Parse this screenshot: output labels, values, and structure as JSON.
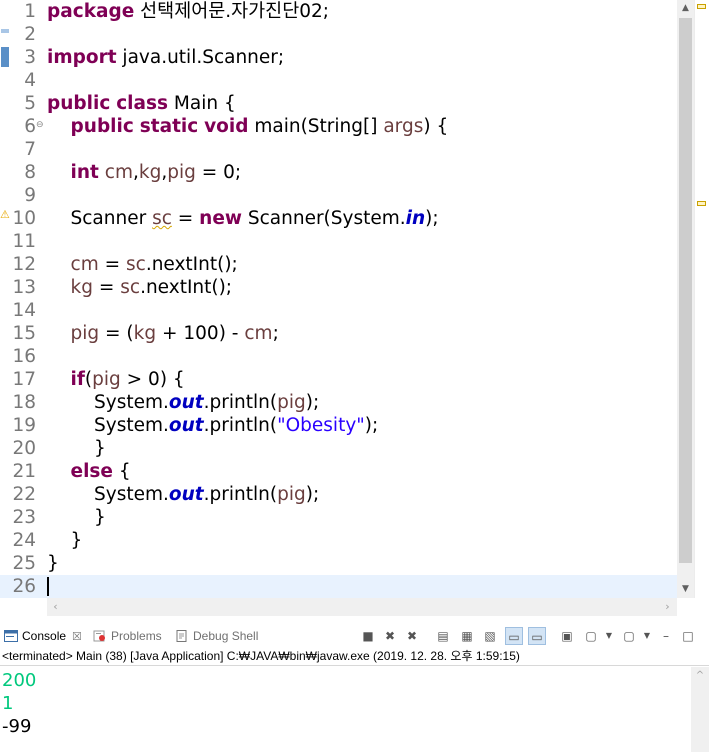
{
  "editor": {
    "lines": [
      {
        "n": "1",
        "tokens": [
          {
            "t": "package",
            "c": "kw"
          },
          {
            "t": " 선택제어문.자가진단02;",
            "c": ""
          }
        ]
      },
      {
        "n": "2",
        "tokens": []
      },
      {
        "n": "3",
        "tokens": [
          {
            "t": "import",
            "c": "kw"
          },
          {
            "t": " java.util.Scanner;",
            "c": ""
          }
        ]
      },
      {
        "n": "4",
        "tokens": []
      },
      {
        "n": "5",
        "tokens": [
          {
            "t": "public",
            "c": "kw"
          },
          {
            "t": " ",
            "c": ""
          },
          {
            "t": "class",
            "c": "kw"
          },
          {
            "t": " Main {",
            "c": ""
          }
        ]
      },
      {
        "n": "6",
        "fold": true,
        "tokens": [
          {
            "t": "    ",
            "c": ""
          },
          {
            "t": "public",
            "c": "kw"
          },
          {
            "t": " ",
            "c": ""
          },
          {
            "t": "static",
            "c": "kw"
          },
          {
            "t": " ",
            "c": ""
          },
          {
            "t": "void",
            "c": "kw"
          },
          {
            "t": " main(String[] ",
            "c": ""
          },
          {
            "t": "args",
            "c": "var"
          },
          {
            "t": ") {",
            "c": ""
          }
        ]
      },
      {
        "n": "7",
        "tokens": []
      },
      {
        "n": "8",
        "tokens": [
          {
            "t": "    ",
            "c": ""
          },
          {
            "t": "int",
            "c": "kw"
          },
          {
            "t": " ",
            "c": ""
          },
          {
            "t": "cm",
            "c": "var"
          },
          {
            "t": ",",
            "c": ""
          },
          {
            "t": "kg",
            "c": "var"
          },
          {
            "t": ",",
            "c": ""
          },
          {
            "t": "pig",
            "c": "var"
          },
          {
            "t": " = 0;",
            "c": ""
          }
        ]
      },
      {
        "n": "9",
        "tokens": []
      },
      {
        "n": "10",
        "warn": true,
        "tokens": [
          {
            "t": "    Scanner ",
            "c": ""
          },
          {
            "t": "sc",
            "c": "var squig"
          },
          {
            "t": " = ",
            "c": ""
          },
          {
            "t": "new",
            "c": "kw"
          },
          {
            "t": " Scanner(System.",
            "c": ""
          },
          {
            "t": "in",
            "c": "fld"
          },
          {
            "t": ");",
            "c": ""
          }
        ]
      },
      {
        "n": "11",
        "tokens": []
      },
      {
        "n": "12",
        "tokens": [
          {
            "t": "    ",
            "c": ""
          },
          {
            "t": "cm",
            "c": "var"
          },
          {
            "t": " = ",
            "c": ""
          },
          {
            "t": "sc",
            "c": "var"
          },
          {
            "t": ".nextInt();",
            "c": ""
          }
        ]
      },
      {
        "n": "13",
        "tokens": [
          {
            "t": "    ",
            "c": ""
          },
          {
            "t": "kg",
            "c": "var"
          },
          {
            "t": " = ",
            "c": ""
          },
          {
            "t": "sc",
            "c": "var"
          },
          {
            "t": ".nextInt();",
            "c": ""
          }
        ]
      },
      {
        "n": "14",
        "tokens": []
      },
      {
        "n": "15",
        "tokens": [
          {
            "t": "    ",
            "c": ""
          },
          {
            "t": "pig",
            "c": "var"
          },
          {
            "t": " = (",
            "c": ""
          },
          {
            "t": "kg",
            "c": "var"
          },
          {
            "t": " + 100) - ",
            "c": ""
          },
          {
            "t": "cm",
            "c": "var"
          },
          {
            "t": ";",
            "c": ""
          }
        ]
      },
      {
        "n": "16",
        "tokens": []
      },
      {
        "n": "17",
        "tokens": [
          {
            "t": "    ",
            "c": ""
          },
          {
            "t": "if",
            "c": "kw"
          },
          {
            "t": "(",
            "c": ""
          },
          {
            "t": "pig",
            "c": "var"
          },
          {
            "t": " > 0) {",
            "c": ""
          }
        ]
      },
      {
        "n": "18",
        "tokens": [
          {
            "t": "        System.",
            "c": ""
          },
          {
            "t": "out",
            "c": "fld"
          },
          {
            "t": ".println(",
            "c": ""
          },
          {
            "t": "pig",
            "c": "var"
          },
          {
            "t": ");",
            "c": ""
          }
        ]
      },
      {
        "n": "19",
        "tokens": [
          {
            "t": "        System.",
            "c": ""
          },
          {
            "t": "out",
            "c": "fld"
          },
          {
            "t": ".println(",
            "c": ""
          },
          {
            "t": "\"Obesity\"",
            "c": "str"
          },
          {
            "t": ");",
            "c": ""
          }
        ]
      },
      {
        "n": "20",
        "tokens": [
          {
            "t": "        }",
            "c": ""
          }
        ]
      },
      {
        "n": "21",
        "tokens": [
          {
            "t": "    ",
            "c": ""
          },
          {
            "t": "else",
            "c": "kw"
          },
          {
            "t": " {",
            "c": ""
          }
        ]
      },
      {
        "n": "22",
        "tokens": [
          {
            "t": "        System.",
            "c": ""
          },
          {
            "t": "out",
            "c": "fld"
          },
          {
            "t": ".println(",
            "c": ""
          },
          {
            "t": "pig",
            "c": "var"
          },
          {
            "t": ");",
            "c": ""
          }
        ]
      },
      {
        "n": "23",
        "tokens": [
          {
            "t": "        }",
            "c": ""
          }
        ]
      },
      {
        "n": "24",
        "tokens": [
          {
            "t": "    }",
            "c": ""
          }
        ]
      },
      {
        "n": "25",
        "tokens": [
          {
            "t": "}",
            "c": ""
          }
        ]
      },
      {
        "n": "26",
        "current": true,
        "tokens": []
      }
    ]
  },
  "console": {
    "tabs": [
      {
        "label": "Console",
        "active": true,
        "icon": "console-icon"
      },
      {
        "label": "Problems",
        "active": false,
        "icon": "problems-icon"
      },
      {
        "label": "Debug Shell",
        "active": false,
        "icon": "debug-shell-icon"
      }
    ],
    "close_glyph": "☒",
    "status": "<terminated> Main (38) [Java Application] C:₩JAVA₩bin₩javaw.exe (2019. 12. 28. 오후 1:59:15)",
    "output": [
      {
        "text": "200",
        "kind": "in"
      },
      {
        "text": "1",
        "kind": "in"
      },
      {
        "text": "-99",
        "kind": "std"
      }
    ]
  },
  "colors": {
    "keyword": "#7f0055",
    "local_var": "#6a3e3e",
    "static_field": "#0000c0",
    "string": "#2a00ff",
    "console_input": "#00c87d",
    "current_line": "#e8f2fe"
  }
}
